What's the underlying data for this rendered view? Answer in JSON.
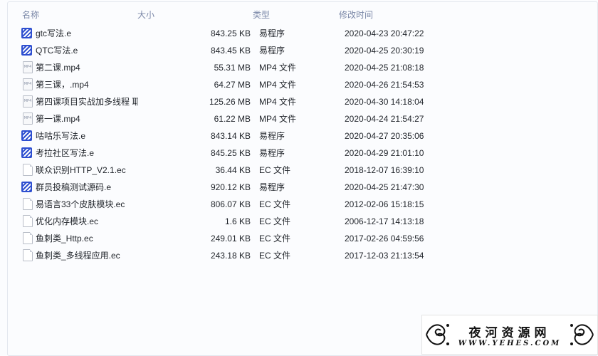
{
  "columns": {
    "name": "名称",
    "size": "大小",
    "type": "类型",
    "date": "修改时间"
  },
  "files": [
    {
      "icon": "e-program-icon",
      "name": "gtc写法.e",
      "size": "843.25 KB",
      "type": "易程序",
      "date": "2020-04-23 20:47:22"
    },
    {
      "icon": "e-program-icon",
      "name": "QTC写法.e",
      "size": "843.45 KB",
      "type": "易程序",
      "date": "2020-04-25 20:30:19"
    },
    {
      "icon": "mp4-file-icon",
      "name": "第二课.mp4",
      "size": "55.31 MB",
      "type": "MP4 文件",
      "date": "2020-04-25 21:08:18"
    },
    {
      "icon": "mp4-file-icon",
      "name": "第三课，.mp4",
      "size": "64.27 MB",
      "type": "MP4 文件",
      "date": "2020-04-26 21:54:53"
    },
    {
      "icon": "mp4-file-icon",
      "name": "第四课项目实战加多线程 耶",
      "size": "125.26 MB",
      "type": "MP4 文件",
      "date": "2020-04-30 14:18:04"
    },
    {
      "icon": "mp4-file-icon",
      "name": "第一课.mp4",
      "size": "61.22 MB",
      "type": "MP4 文件",
      "date": "2020-04-24 21:54:27"
    },
    {
      "icon": "e-program-icon",
      "name": "咕咕乐写法.e",
      "size": "843.14 KB",
      "type": "易程序",
      "date": "2020-04-27 20:35:06"
    },
    {
      "icon": "e-program-icon",
      "name": "考拉社区写法.e",
      "size": "845.25 KB",
      "type": "易程序",
      "date": "2020-04-29 21:01:10"
    },
    {
      "icon": "ec-file-icon",
      "name": "联众识别HTTP_V2.1.ec",
      "size": "36.44 KB",
      "type": "EC 文件",
      "date": "2018-12-07 16:39:10"
    },
    {
      "icon": "e-program-icon",
      "name": "群员投稿测试源码.e",
      "size": "920.12 KB",
      "type": "易程序",
      "date": "2020-04-25 21:47:30"
    },
    {
      "icon": "ec-file-icon",
      "name": "易语言33个皮肤模块.ec",
      "size": "806.07 KB",
      "type": "EC 文件",
      "date": "2012-02-06 15:18:15"
    },
    {
      "icon": "ec-file-icon",
      "name": "优化内存模块.ec",
      "size": "1.6 KB",
      "type": "EC 文件",
      "date": "2006-12-17 14:13:18"
    },
    {
      "icon": "ec-file-icon",
      "name": "鱼刺类_Http.ec",
      "size": "249.01 KB",
      "type": "EC 文件",
      "date": "2017-02-26 04:59:56"
    },
    {
      "icon": "ec-file-icon",
      "name": "鱼刺类_多线程应用.ec",
      "size": "243.18 KB",
      "type": "EC 文件",
      "date": "2017-12-03 21:13:54"
    }
  ],
  "mp4_icon_text": "MP4",
  "watermark": {
    "title": "夜河资源网",
    "url": "WWW.YEHES.COM"
  }
}
